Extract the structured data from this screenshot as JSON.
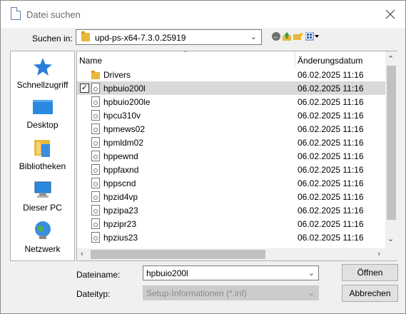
{
  "window": {
    "title": "Datei suchen"
  },
  "toolbar": {
    "lookin_label": "Suchen in:",
    "lookin_value": "upd-ps-x64-7.3.0.25919",
    "icons": [
      "back-icon",
      "up-folder-icon",
      "new-folder-icon",
      "view-menu-icon"
    ]
  },
  "sidebar": {
    "items": [
      {
        "label": "Schnellzugriff",
        "icon": "star-icon"
      },
      {
        "label": "Desktop",
        "icon": "desktop-icon"
      },
      {
        "label": "Bibliotheken",
        "icon": "libraries-icon"
      },
      {
        "label": "Dieser PC",
        "icon": "computer-icon"
      },
      {
        "label": "Netzwerk",
        "icon": "network-icon"
      }
    ]
  },
  "filelist": {
    "columns": {
      "name": "Name",
      "date": "Änderungsdatum"
    },
    "rows": [
      {
        "name": "Drivers",
        "date": "06.02.2025 11:16",
        "type": "folder",
        "selected": false
      },
      {
        "name": "hpbuio200l",
        "date": "06.02.2025 11:16",
        "type": "file",
        "selected": true
      },
      {
        "name": "hpbuio200le",
        "date": "06.02.2025 11:16",
        "type": "file",
        "selected": false
      },
      {
        "name": "hpcu310v",
        "date": "06.02.2025 11:16",
        "type": "file",
        "selected": false
      },
      {
        "name": "hpmews02",
        "date": "06.02.2025 11:16",
        "type": "file",
        "selected": false
      },
      {
        "name": "hpmldm02",
        "date": "06.02.2025 11:16",
        "type": "file",
        "selected": false
      },
      {
        "name": "hppewnd",
        "date": "06.02.2025 11:16",
        "type": "file",
        "selected": false
      },
      {
        "name": "hppfaxnd",
        "date": "06.02.2025 11:16",
        "type": "file",
        "selected": false
      },
      {
        "name": "hppscnd",
        "date": "06.02.2025 11:16",
        "type": "file",
        "selected": false
      },
      {
        "name": "hpzid4vp",
        "date": "06.02.2025 11:16",
        "type": "file",
        "selected": false
      },
      {
        "name": "hpzipa23",
        "date": "06.02.2025 11:16",
        "type": "file",
        "selected": false
      },
      {
        "name": "hpzipr23",
        "date": "06.02.2025 11:16",
        "type": "file",
        "selected": false
      },
      {
        "name": "hpzius23",
        "date": "06.02.2025 11:16",
        "type": "file",
        "selected": false
      }
    ]
  },
  "footer": {
    "filename_label": "Dateiname:",
    "filename_value": "hpbuio200l",
    "filetype_label": "Dateityp:",
    "filetype_value": "Setup-Informationen (*.inf)",
    "open_label": "Öffnen",
    "cancel_label": "Abbrechen"
  },
  "colors": {
    "folder": "#e8b83e",
    "selection": "#d9d9d9",
    "accent": "#2a7fd8"
  }
}
